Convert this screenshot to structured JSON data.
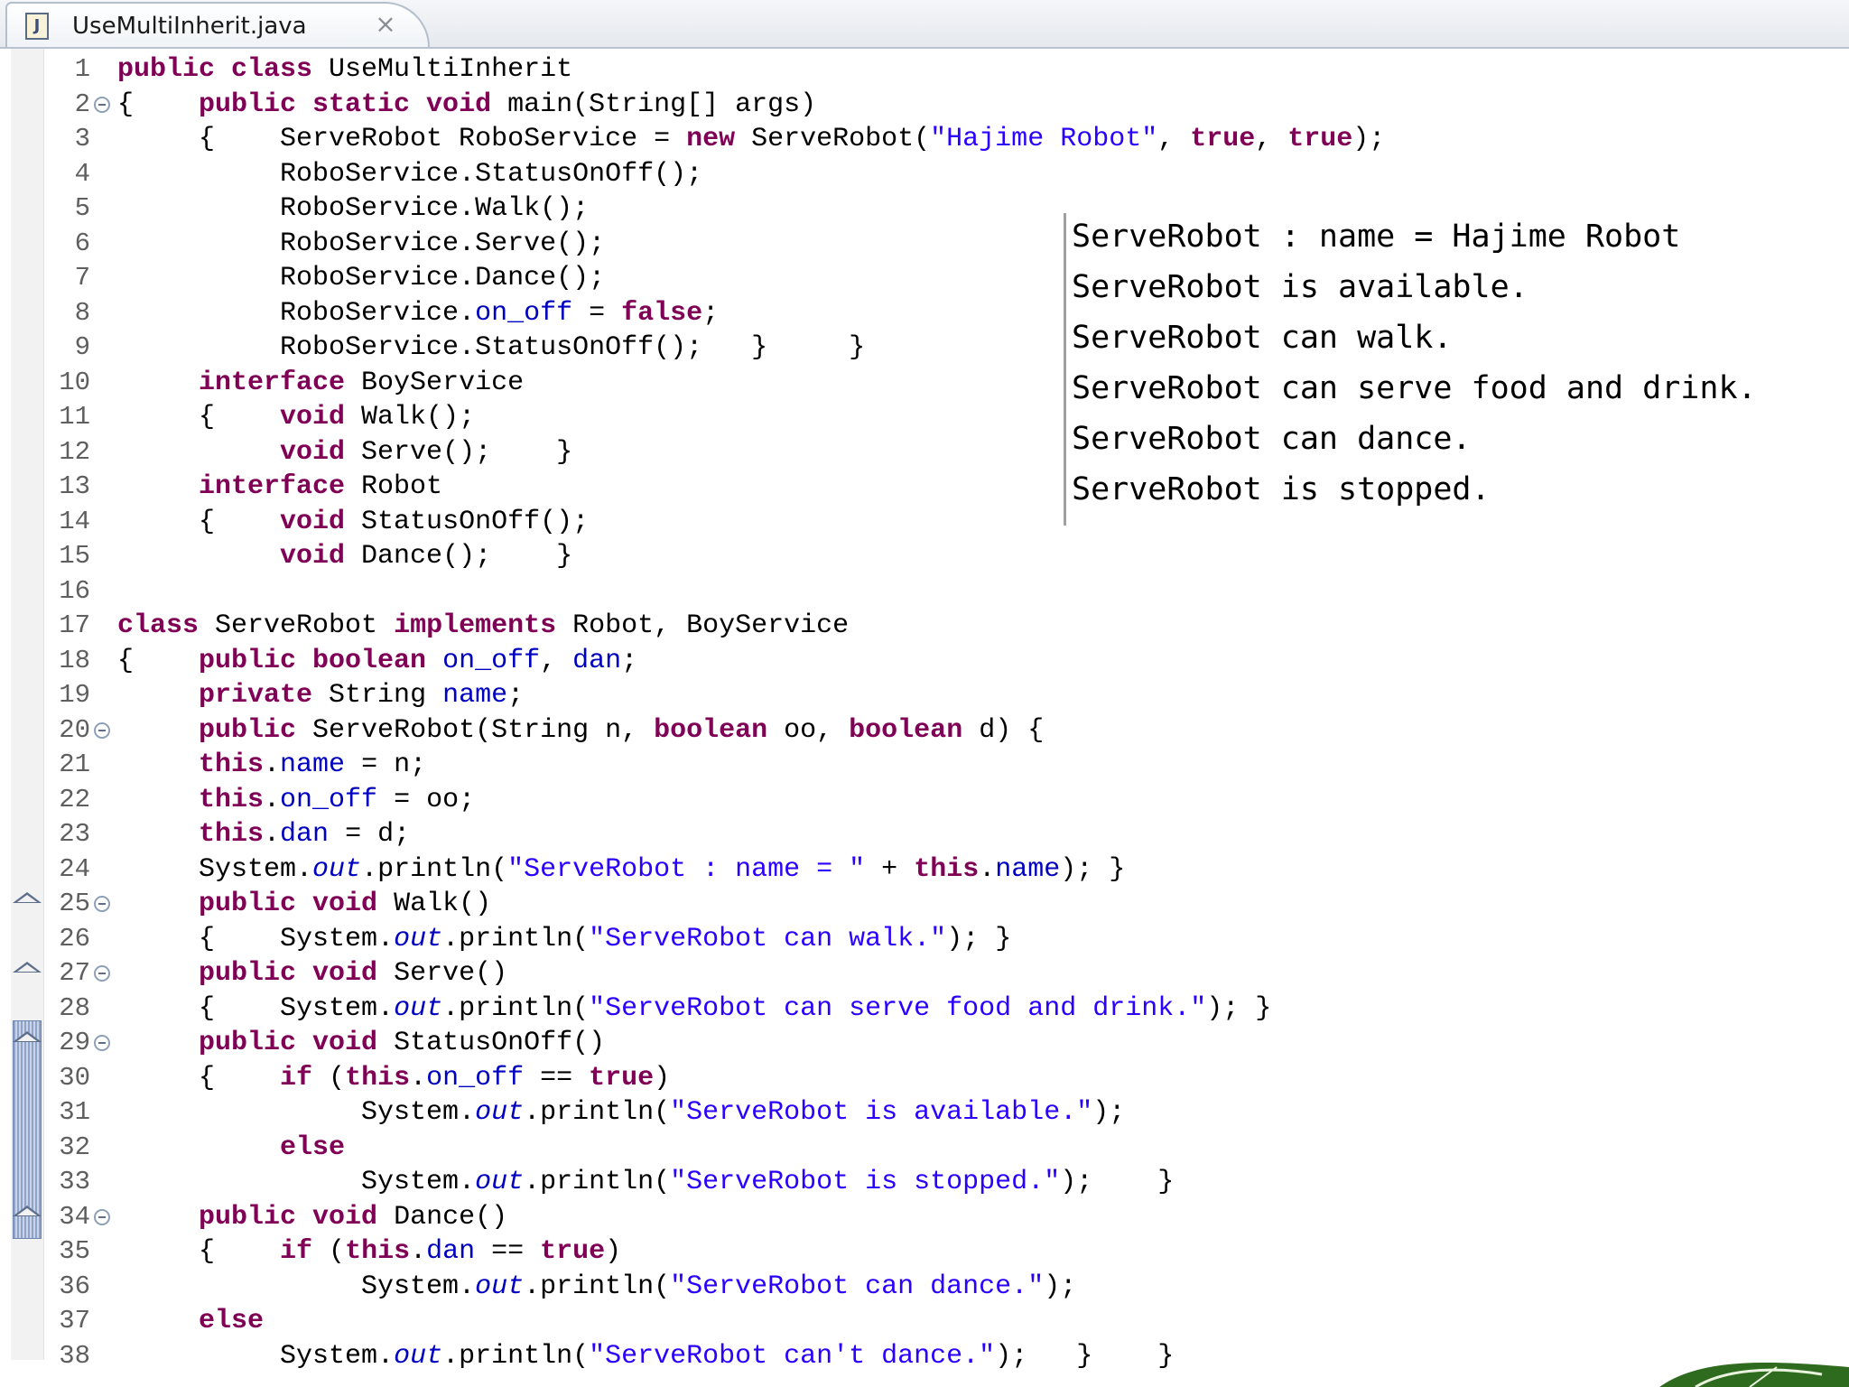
{
  "tab": {
    "title": "UseMultiInherit.java",
    "icon": "java-file-icon",
    "close_icon": "close-icon",
    "close_glyph": "⨯"
  },
  "colors": {
    "keyword": "#7f0055",
    "field": "#0000c0",
    "string": "#2a00ff",
    "plain": "#000000",
    "line_number": "#5f5f5f"
  },
  "editor": {
    "lines": [
      {
        "n": "1",
        "html": "<span class=\"kw\">public class</span> UseMultiInherit"
      },
      {
        "n": "2",
        "fold": true,
        "html": "{    <span class=\"kw\">public static void</span> main(String[] args)"
      },
      {
        "n": "3",
        "html": "     {    ServeRobot RoboService = <span class=\"kw\">new</span> ServeRobot(<span class=\"st\">\"Hajime Robot\"</span>, <span class=\"kw\">true</span>, <span class=\"kw\">true</span>);"
      },
      {
        "n": "4",
        "html": "          RoboService.StatusOnOff();"
      },
      {
        "n": "5",
        "html": "          RoboService.Walk();"
      },
      {
        "n": "6",
        "html": "          RoboService.Serve();"
      },
      {
        "n": "7",
        "html": "          RoboService.Dance();"
      },
      {
        "n": "8",
        "html": "          RoboService.<span class=\"fd\">on_off</span> = <span class=\"kw\">false</span>;"
      },
      {
        "n": "9",
        "html": "          RoboService.StatusOnOff();   }     }"
      },
      {
        "n": "10",
        "html": "     <span class=\"kw\">interface</span> BoyService"
      },
      {
        "n": "11",
        "html": "     {    <span class=\"kw\">void</span> Walk();"
      },
      {
        "n": "12",
        "html": "          <span class=\"kw\">void</span> Serve();    }"
      },
      {
        "n": "13",
        "html": "     <span class=\"kw\">interface</span> Robot"
      },
      {
        "n": "14",
        "html": "     {    <span class=\"kw\">void</span> StatusOnOff();"
      },
      {
        "n": "15",
        "html": "          <span class=\"kw\">void</span> Dance();    }"
      },
      {
        "n": "16",
        "html": ""
      },
      {
        "n": "17",
        "html": "<span class=\"kw\">class</span> ServeRobot <span class=\"kw\">implements</span> Robot, BoyService"
      },
      {
        "n": "18",
        "html": "{    <span class=\"kw\">public boolean</span> <span class=\"fd\">on_off</span>, <span class=\"fd\">dan</span>;"
      },
      {
        "n": "19",
        "html": "     <span class=\"kw\">private</span> String <span class=\"fd\">name</span>;"
      },
      {
        "n": "20",
        "fold": true,
        "html": "     <span class=\"kw\">public</span> ServeRobot(String n, <span class=\"kw\">boolean</span> oo, <span class=\"kw\">boolean</span> d) {"
      },
      {
        "n": "21",
        "html": "     <span class=\"kw\">this</span>.<span class=\"fd\">name</span> = n;"
      },
      {
        "n": "22",
        "html": "     <span class=\"kw\">this</span>.<span class=\"fd\">on_off</span> = oo;"
      },
      {
        "n": "23",
        "html": "     <span class=\"kw\">this</span>.<span class=\"fd\">dan</span> = d;"
      },
      {
        "n": "24",
        "html": "     System.<span class=\"it\">out</span>.println(<span class=\"st\">\"ServeRobot : name = \"</span> + <span class=\"kw\">this</span>.<span class=\"fd\">name</span>); }"
      },
      {
        "n": "25",
        "fold": true,
        "override": true,
        "html": "     <span class=\"kw\">public void</span> Walk()"
      },
      {
        "n": "26",
        "html": "     {    System.<span class=\"it\">out</span>.println(<span class=\"st\">\"ServeRobot can walk.\"</span>); }"
      },
      {
        "n": "27",
        "fold": true,
        "override": true,
        "html": "     <span class=\"kw\">public void</span> Serve()"
      },
      {
        "n": "28",
        "html": "     {    System.<span class=\"it\">out</span>.println(<span class=\"st\">\"ServeRobot can serve food and drink.\"</span>); }"
      },
      {
        "n": "29",
        "fold": true,
        "override": true,
        "html": "     <span class=\"kw\">public void</span> StatusOnOff()"
      },
      {
        "n": "30",
        "html": "     {    <span class=\"kw\">if</span> (<span class=\"kw\">this</span>.<span class=\"fd\">on_off</span> == <span class=\"kw\">true</span>)"
      },
      {
        "n": "31",
        "html": "               System.<span class=\"it\">out</span>.println(<span class=\"st\">\"ServeRobot is available.\"</span>);"
      },
      {
        "n": "32",
        "html": "          <span class=\"kw\">else</span>"
      },
      {
        "n": "33",
        "html": "               System.<span class=\"it\">out</span>.println(<span class=\"st\">\"ServeRobot is stopped.\"</span>);    }"
      },
      {
        "n": "34",
        "fold": true,
        "override": true,
        "html": "     <span class=\"kw\">public void</span> Dance()"
      },
      {
        "n": "35",
        "html": "     {    <span class=\"kw\">if</span> (<span class=\"kw\">this</span>.<span class=\"fd\">dan</span> == <span class=\"kw\">true</span>)"
      },
      {
        "n": "36",
        "html": "               System.<span class=\"it\">out</span>.println(<span class=\"st\">\"ServeRobot can dance.\"</span>);"
      },
      {
        "n": "37",
        "html": "     <span class=\"kw\">else</span>"
      },
      {
        "n": "38",
        "html": "          System.<span class=\"it\">out</span>.println(<span class=\"st\">\"ServeRobot can't dance.\"</span>);   }    }"
      }
    ]
  },
  "console": {
    "lines": [
      "ServeRobot : name = Hajime Robot",
      "ServeRobot is available.",
      "ServeRobot can walk.",
      "ServeRobot can serve food and drink.",
      "ServeRobot can dance.",
      "ServeRobot is stopped."
    ]
  }
}
